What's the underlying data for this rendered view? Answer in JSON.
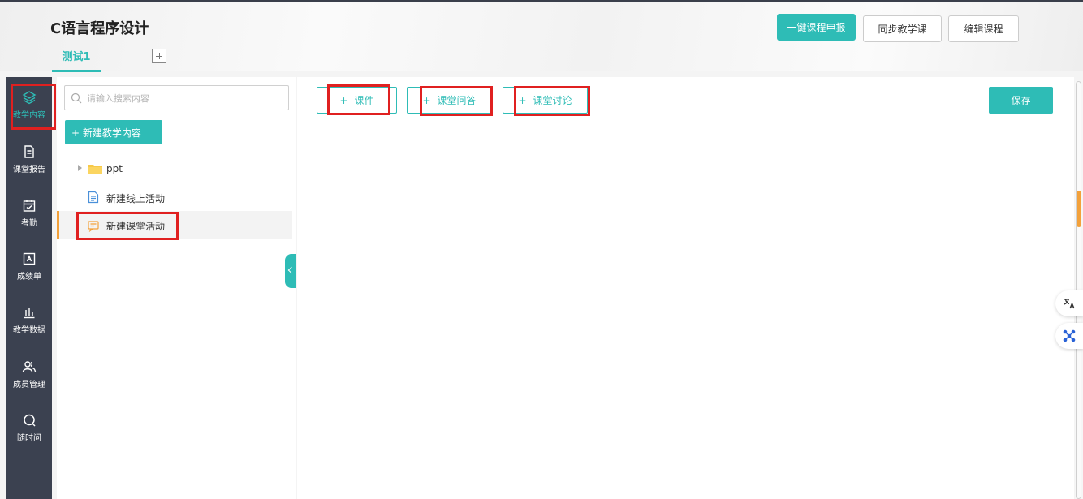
{
  "header": {
    "course_title": "C语言程序设计",
    "tabs": [
      {
        "label": "测试1",
        "active": true
      }
    ],
    "actions": {
      "report": "一键课程申报",
      "sync": "同步教学课",
      "edit": "编辑课程"
    }
  },
  "sidebar": {
    "items": [
      {
        "label": "教学内容",
        "icon": "layers-icon",
        "active": true
      },
      {
        "label": "课堂报告",
        "icon": "report-icon"
      },
      {
        "label": "考勤",
        "icon": "calendar-check-icon"
      },
      {
        "label": "成绩单",
        "icon": "grade-icon"
      },
      {
        "label": "教学数据",
        "icon": "bar-chart-icon"
      },
      {
        "label": "成员管理",
        "icon": "members-icon"
      },
      {
        "label": "随时问",
        "icon": "chat-icon"
      }
    ]
  },
  "tree": {
    "search_placeholder": "请输入搜索内容",
    "new_button": "+ 新建教学内容",
    "items": [
      {
        "label": "ppt",
        "icon": "folder-icon",
        "expandable": true
      },
      {
        "label": "新建线上活动",
        "icon": "document-icon"
      },
      {
        "label": "新建课堂活动",
        "icon": "chat-doc-icon",
        "selected": true
      }
    ]
  },
  "main": {
    "add_buttons": [
      "课件",
      "课堂问答",
      "课堂讨论"
    ],
    "plus": "+",
    "save": "保存"
  },
  "colors": {
    "accent": "#2ebcb6",
    "nav_bg": "#3b4150",
    "highlight": "#e02020",
    "selected_marker": "#f3a13b"
  }
}
